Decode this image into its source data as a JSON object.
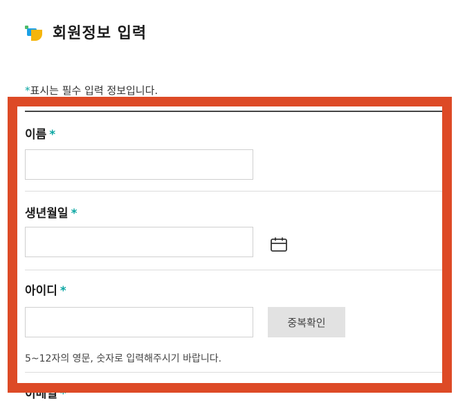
{
  "page": {
    "title": "회원정보 입력",
    "required_note_star": "*",
    "required_note_text": "표시는 필수 입력 정보입니다."
  },
  "form": {
    "required_mark": "*",
    "fields": {
      "name": {
        "label": "이름",
        "value": ""
      },
      "birthdate": {
        "label": "생년월일",
        "value": "",
        "icon": "calendar-icon"
      },
      "user_id": {
        "label": "아이디",
        "value": "",
        "button_label": "중복확인",
        "hint": "5~12자의 영문, 숫자로 입력해주시기 바랍니다."
      },
      "email": {
        "label": "이메일"
      }
    }
  },
  "colors": {
    "accent_star": "#0aa6a2",
    "highlight_border": "#dd4a26",
    "button_bg": "#e2e2e2"
  }
}
